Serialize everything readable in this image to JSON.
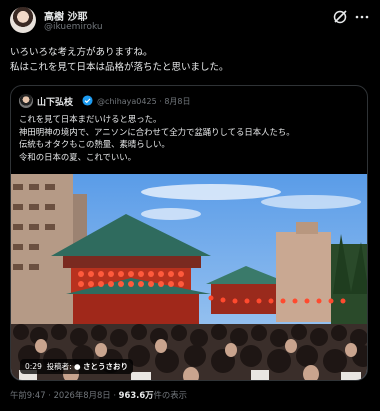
{
  "author": {
    "name": "高樹 沙耶",
    "handle": "@ikuemiroku"
  },
  "post": {
    "lines": [
      "いろいろな考え方がありますね。",
      "私はこれを見て日本は品格が落ちたと思いました。"
    ]
  },
  "icons": {
    "grok": "grok-slash-icon",
    "more": "more-dots-icon",
    "verified": "verified-badge-icon"
  },
  "quoted": {
    "name": "山下弘枝",
    "handle": "@chihaya0425",
    "separator": "·",
    "date": "8月8日",
    "lines": [
      "これを見て日本まだいけると思った。",
      "神田明神の境内で、アニソンに合わせて全力で盆踊りしてる日本人たち。",
      "伝統もオタクもこの熱量、素晴らしい。",
      "令和の日本の夏、これでいい。"
    ],
    "video": {
      "duration": "0:29",
      "poster_label": "投稿者:",
      "poster_name": "さとうさおり"
    }
  },
  "meta": {
    "time": "午前9:47",
    "sep1": " · ",
    "date": "2026年8月8日",
    "sep2": " · ",
    "views": "963.6万",
    "views_suffix": "件の表示"
  },
  "colors": {
    "background": "#000000",
    "text": "#e7e9ea",
    "muted": "#71767b",
    "verified": "#1d9bf0",
    "border": "#2f3336"
  }
}
